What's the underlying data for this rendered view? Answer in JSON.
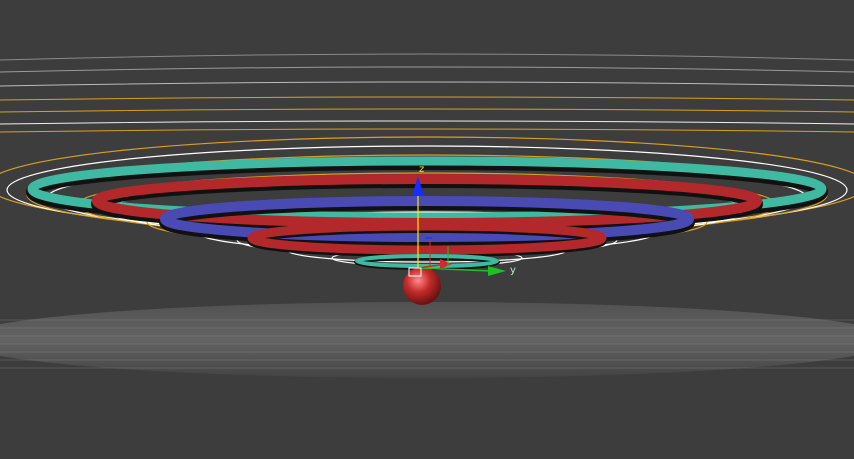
{
  "viewport": {
    "background": "#3d3d3d",
    "floor_color": "#6a6a6a",
    "grid_color": "#8a8a8a"
  },
  "gizmo": {
    "axis_z_label": "z",
    "axis_y_label": "y",
    "colors": {
      "z": "#1a2cff",
      "y": "#1fbf2a",
      "x": "#d42a2a",
      "pivot": "#ffe400"
    }
  },
  "object": {
    "icon": "sphere-icon",
    "color": "#b3282a"
  },
  "rings": {
    "colors": [
      "#3fb9a1",
      "#b3282a",
      "#4a4ab5",
      "#b3282a",
      "#3fb9a1"
    ],
    "spline_colors": [
      "#d9a021",
      "#ffffff"
    ]
  }
}
